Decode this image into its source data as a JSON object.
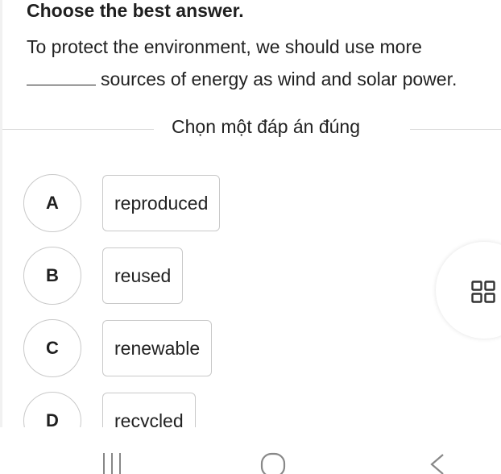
{
  "quiz": {
    "instruction": "Choose the best answer.",
    "question_line1": "To protect the environment, we should use more",
    "question_line2": "sources of energy as wind and solar power.",
    "choose_prompt": "Chọn một đáp án đúng",
    "options": [
      {
        "letter": "A",
        "text": "reproduced"
      },
      {
        "letter": "B",
        "text": "reused"
      },
      {
        "letter": "C",
        "text": "renewable"
      },
      {
        "letter": "D",
        "text": "recycled"
      }
    ]
  },
  "floating_button": {
    "icon": "grid-icon"
  },
  "nav_bar": {
    "buttons": [
      "recent-apps-icon",
      "home-icon",
      "back-icon"
    ]
  },
  "colors": {
    "text": "#1f1f1f",
    "border": "#c9c9c9",
    "divider": "#d9d9d9",
    "background": "#ffffff"
  }
}
